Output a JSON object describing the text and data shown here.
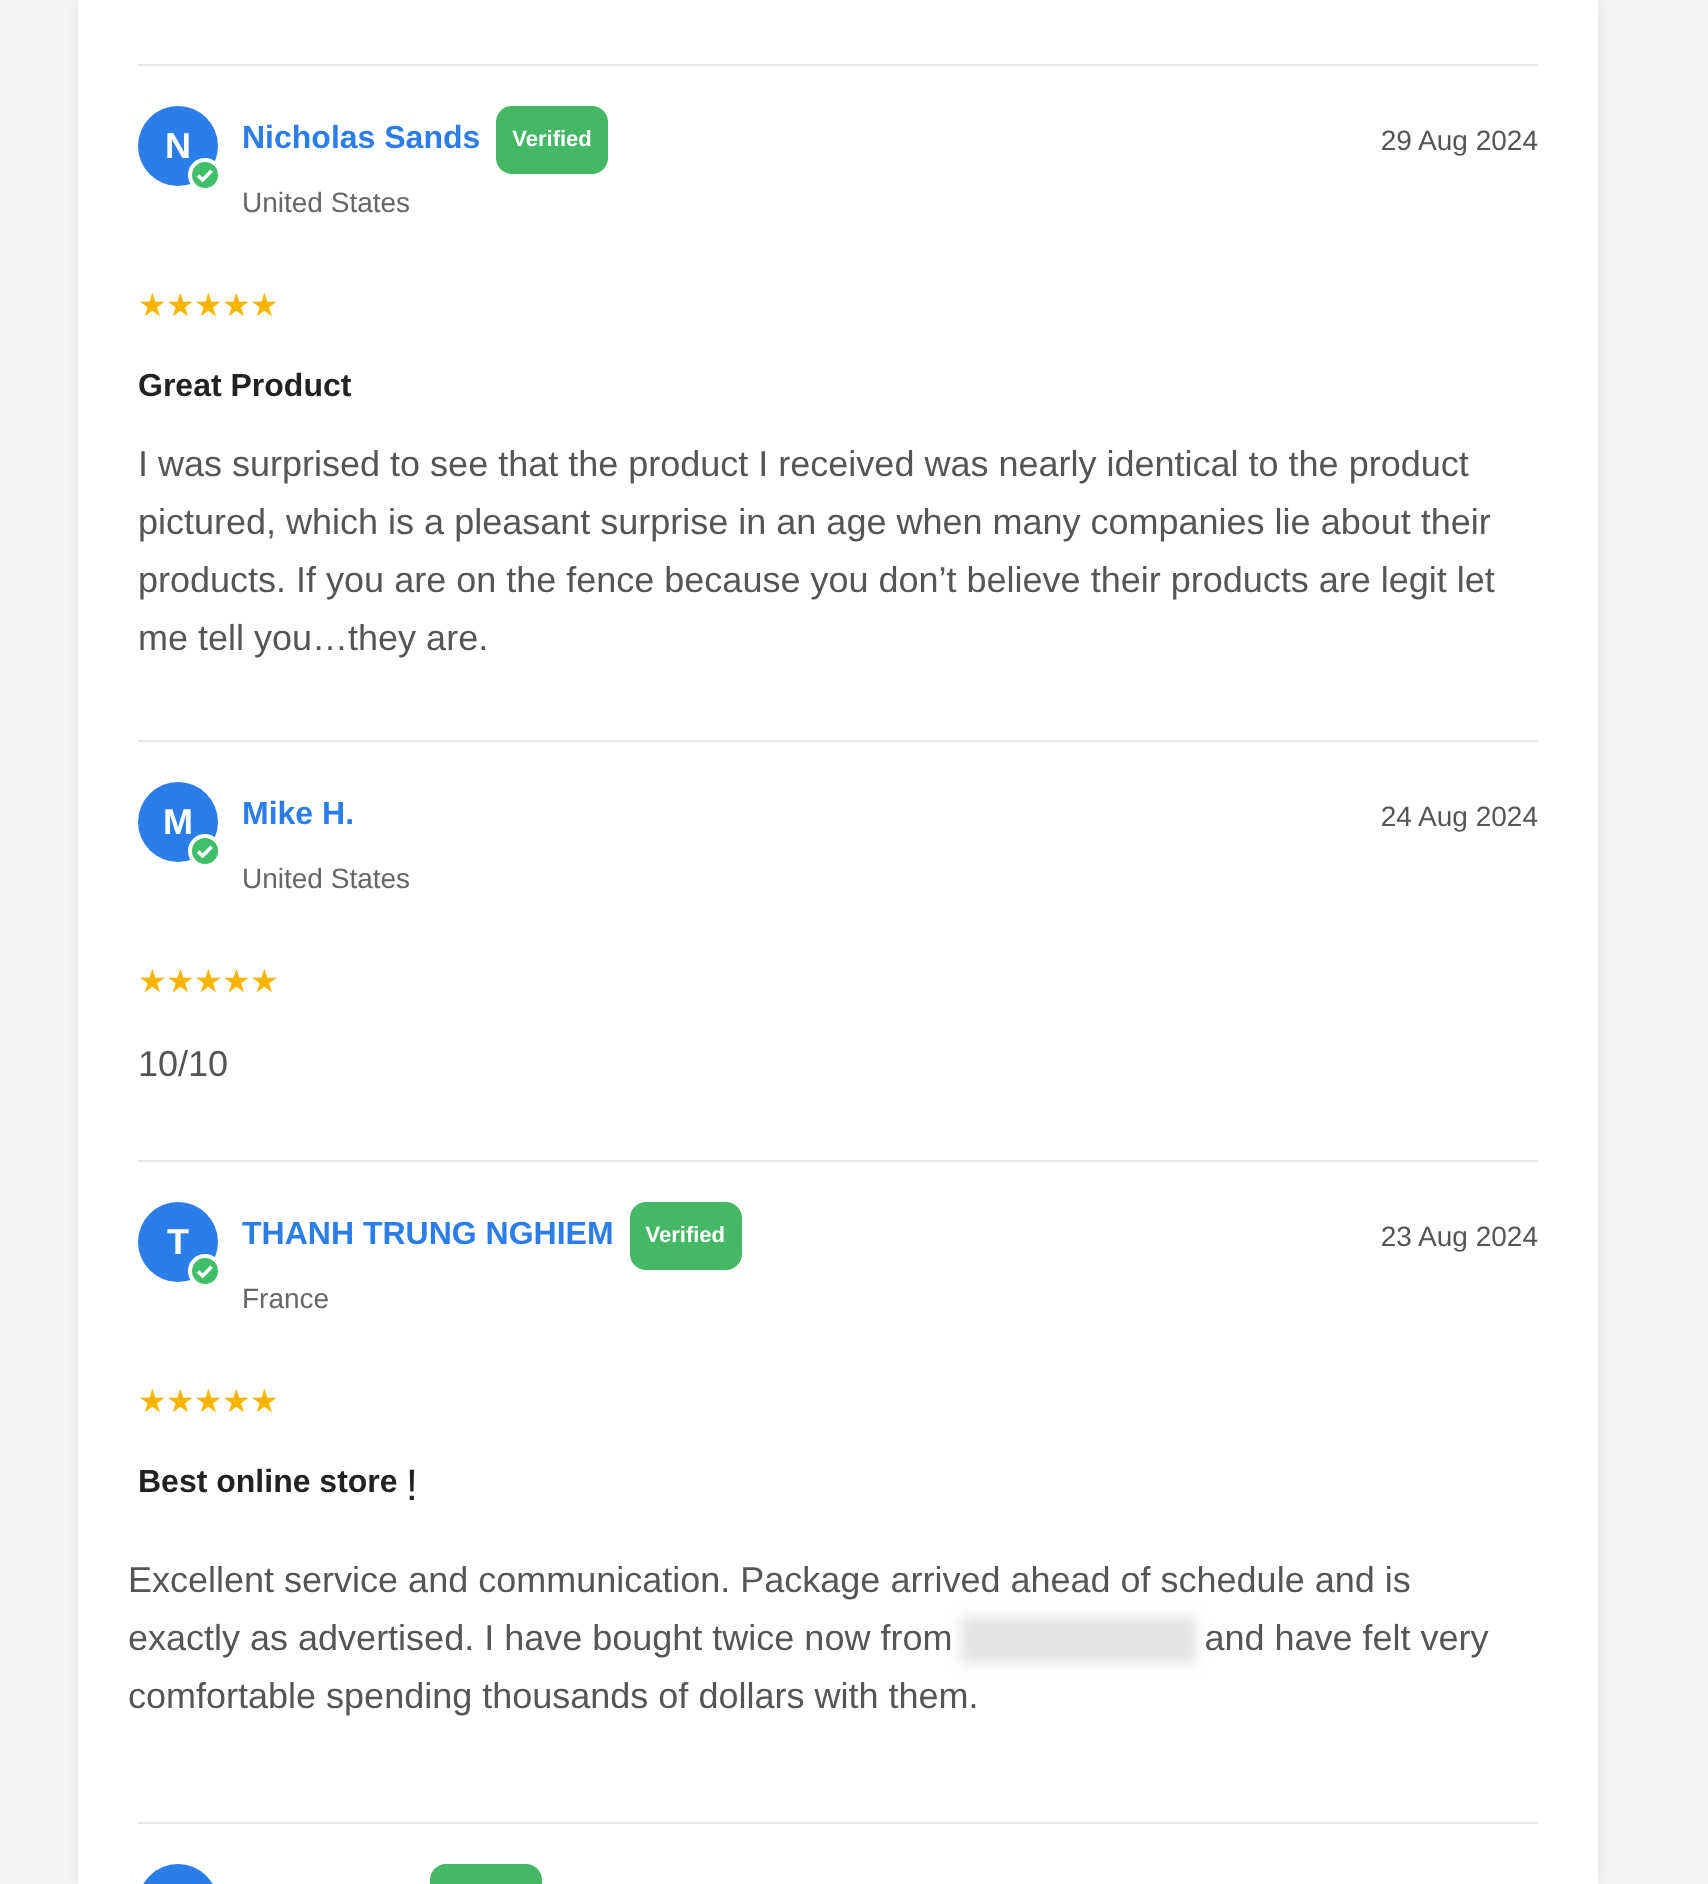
{
  "reviews": [
    {
      "kind": "full",
      "initial": "N",
      "name": "Nicholas Sands",
      "verified": true,
      "badge": "Verified",
      "country": "United States",
      "date": "29 Aug 2024",
      "stars": 5,
      "title": "Great Product",
      "lines": [
        [
          {
            "kind": "text",
            "text": "I was surprised to see that the product I received was nearly identical to the product pictured, which is a pleasant surprise in an age when many companies lie about their products. If you are on the fence because you don’t believe their products are legit let me tell you…they are."
          }
        ]
      ]
    },
    {
      "kind": "full",
      "initial": "M",
      "name": "Mike H.",
      "verified": false,
      "country": "United States",
      "date": "24 Aug 2024",
      "stars": 5,
      "lines": [
        [
          {
            "kind": "text",
            "text": "10/10"
          }
        ]
      ]
    },
    {
      "kind": "full",
      "initial": "T",
      "name": "THANH TRUNG NGHIEM",
      "verified": true,
      "badge": "Verified",
      "country": "France",
      "date": "23 Aug 2024",
      "stars": 5,
      "title": "Best online store",
      "title_mark": "!",
      "lines": [
        [
          {
            "kind": "text",
            "text": "Excellent service and communication. Package arrived ahead of schedule and is"
          }
        ],
        [
          {
            "kind": "text",
            "text": "exactly as advertised. I have bought twice now from"
          },
          {
            "kind": "redacted"
          },
          {
            "kind": "text",
            "text": "and have felt very"
          }
        ],
        [
          {
            "kind": "text",
            "text": "comfortable spending thousands of dollars with them."
          }
        ]
      ]
    },
    {
      "kind": "partial",
      "verified": true
    }
  ],
  "star": "★"
}
